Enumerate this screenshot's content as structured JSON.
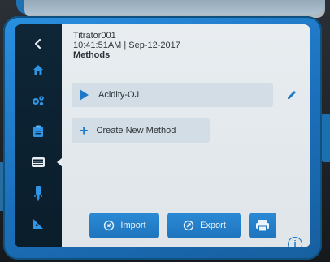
{
  "header": {
    "device_name": "Titrator001",
    "datetime": "10:41:51AM | Sep-12-2017",
    "screen_title": "Methods"
  },
  "sidebar": {
    "items": [
      {
        "icon": "back-chevron-icon"
      },
      {
        "icon": "home-icon"
      },
      {
        "icon": "gears-icon"
      },
      {
        "icon": "clipboard-icon"
      },
      {
        "icon": "methods-list-icon",
        "active": true
      },
      {
        "icon": "electrode-icon"
      },
      {
        "icon": "ruler-triangle-icon"
      }
    ]
  },
  "methods": {
    "items": [
      {
        "label": "Acidity-OJ"
      }
    ],
    "create_label": "Create New Method"
  },
  "toolbar": {
    "import_label": "Import",
    "export_label": "Export",
    "info_label": "i"
  },
  "colors": {
    "accent": "#1e78c8",
    "bezel": "#1f74bd",
    "sidebar": "#0d2130",
    "screen": "#e5eaee"
  }
}
